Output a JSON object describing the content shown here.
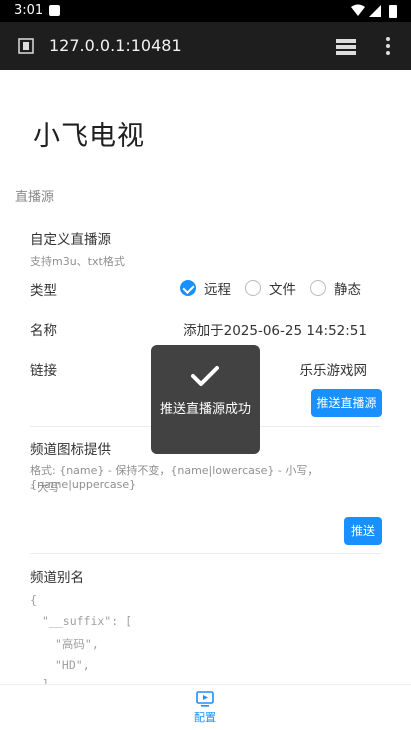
{
  "status_bar": {
    "time": "3:01"
  },
  "browser": {
    "url": "127.0.0.1:10481"
  },
  "app": {
    "title": "小飞电视"
  },
  "section": {
    "label": "直播源"
  },
  "custom_source": {
    "title": "自定义直播源",
    "subtitle": "支持m3u、txt格式",
    "type_label": "类型",
    "type_options": [
      "远程",
      "文件",
      "静态"
    ],
    "type_selected": "远程",
    "name_label": "名称",
    "name_value": "添加于2025-06-25 14:52:51",
    "link_label": "链接",
    "link_value": "乐乐游戏网",
    "push_button": "推送直播源"
  },
  "channel_icon": {
    "title": "频道图标提供",
    "hint_line1": "格式: {name} - 保持不变，{name|lowercase} - 小写，{name|uppercase}",
    "hint_line2": "- 大写",
    "push_button": "推送"
  },
  "channel_alias": {
    "title": "频道别名",
    "json_lines": [
      "{",
      "\"__suffix\": [",
      "\"高码\",",
      "\"HD\",",
      "]"
    ]
  },
  "toast": {
    "message": "推送直播源成功"
  },
  "bottom_nav": {
    "config_label": "配置"
  },
  "colors": {
    "accent": "#1890ff",
    "toolbar": "#1e1e1e"
  }
}
